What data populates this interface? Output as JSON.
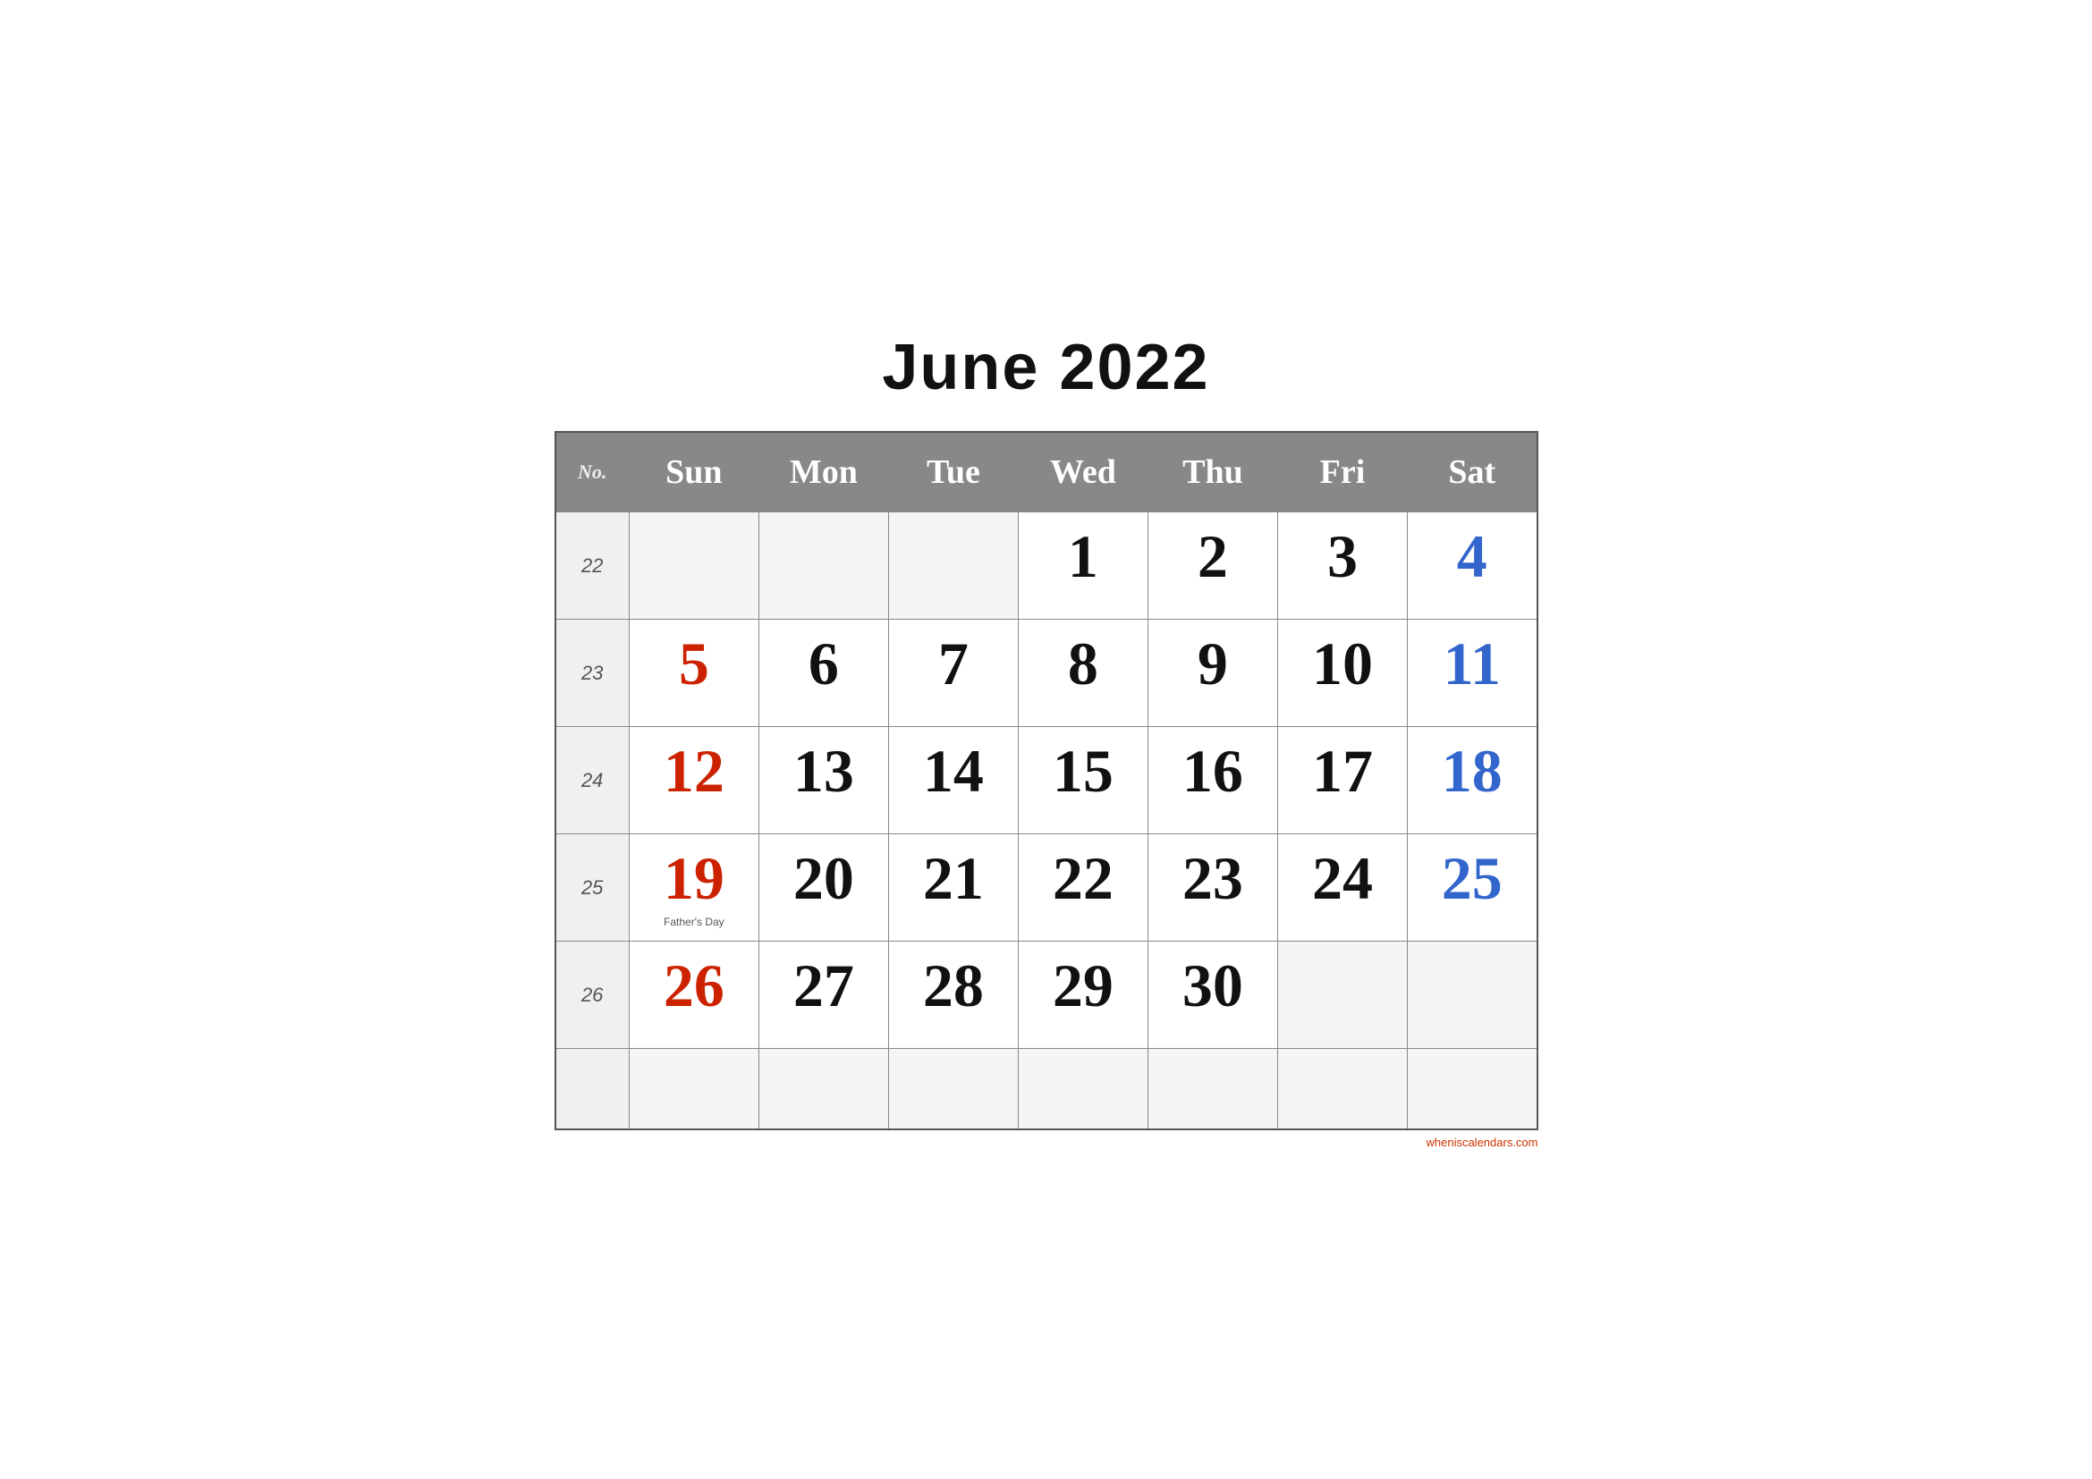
{
  "title": "June 2022",
  "header": {
    "no_label": "No.",
    "days": [
      "Sun",
      "Mon",
      "Tue",
      "Wed",
      "Thu",
      "Fri",
      "Sat"
    ]
  },
  "weeks": [
    {
      "week_num": "22",
      "days": [
        {
          "day": "",
          "type": "empty"
        },
        {
          "day": "",
          "type": "empty"
        },
        {
          "day": "",
          "type": "empty"
        },
        {
          "day": "1",
          "type": "weekday"
        },
        {
          "day": "2",
          "type": "weekday"
        },
        {
          "day": "3",
          "type": "weekday"
        },
        {
          "day": "4",
          "type": "saturday"
        }
      ]
    },
    {
      "week_num": "23",
      "days": [
        {
          "day": "5",
          "type": "sunday"
        },
        {
          "day": "6",
          "type": "weekday"
        },
        {
          "day": "7",
          "type": "weekday"
        },
        {
          "day": "8",
          "type": "weekday"
        },
        {
          "day": "9",
          "type": "weekday"
        },
        {
          "day": "10",
          "type": "weekday"
        },
        {
          "day": "11",
          "type": "saturday"
        }
      ]
    },
    {
      "week_num": "24",
      "days": [
        {
          "day": "12",
          "type": "sunday"
        },
        {
          "day": "13",
          "type": "weekday"
        },
        {
          "day": "14",
          "type": "weekday"
        },
        {
          "day": "15",
          "type": "weekday"
        },
        {
          "day": "16",
          "type": "weekday"
        },
        {
          "day": "17",
          "type": "weekday"
        },
        {
          "day": "18",
          "type": "saturday"
        }
      ]
    },
    {
      "week_num": "25",
      "days": [
        {
          "day": "19",
          "type": "sunday",
          "holiday": "Father's Day"
        },
        {
          "day": "20",
          "type": "weekday"
        },
        {
          "day": "21",
          "type": "weekday"
        },
        {
          "day": "22",
          "type": "weekday"
        },
        {
          "day": "23",
          "type": "weekday"
        },
        {
          "day": "24",
          "type": "weekday"
        },
        {
          "day": "25",
          "type": "saturday"
        }
      ]
    },
    {
      "week_num": "26",
      "days": [
        {
          "day": "26",
          "type": "sunday"
        },
        {
          "day": "27",
          "type": "weekday"
        },
        {
          "day": "28",
          "type": "weekday"
        },
        {
          "day": "29",
          "type": "weekday"
        },
        {
          "day": "30",
          "type": "weekday"
        },
        {
          "day": "",
          "type": "empty"
        },
        {
          "day": "",
          "type": "empty"
        }
      ]
    },
    {
      "week_num": "",
      "days": [
        {
          "day": "",
          "type": "empty"
        },
        {
          "day": "",
          "type": "empty"
        },
        {
          "day": "",
          "type": "empty"
        },
        {
          "day": "",
          "type": "empty"
        },
        {
          "day": "",
          "type": "empty"
        },
        {
          "day": "",
          "type": "empty"
        },
        {
          "day": "",
          "type": "empty"
        }
      ]
    }
  ],
  "watermark": "wheniscalendars.com"
}
